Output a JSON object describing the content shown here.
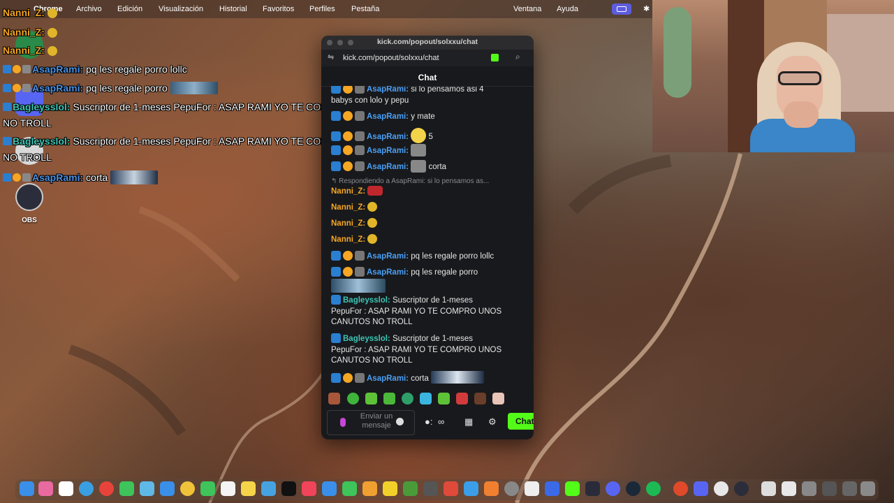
{
  "menubar": {
    "app": "Chrome",
    "items": [
      "Archivo",
      "Edición",
      "Visualización",
      "Historial",
      "Favoritos",
      "Perfiles",
      "Pestaña",
      "Ventana",
      "Ayuda"
    ]
  },
  "overlay": {
    "lines": [
      {
        "user": "Nanni_Z:",
        "text": ""
      },
      {
        "user": "Nanni_Z:",
        "text": ""
      },
      {
        "user": "Nanni_Z:",
        "text": ""
      },
      {
        "user": "AsapRami:",
        "text": " pq les regale porro lollc"
      },
      {
        "user": "AsapRami:",
        "text": " pq les regale porro"
      },
      {
        "user": "Bagleysslol:",
        "text": " Suscriptor de 1-meses PepuFor : ASAP RAMI YO TE COMPRO UNOS CANUTOS"
      },
      {
        "user": "",
        "text": "NO TROLL"
      },
      {
        "user": "Bagleysslol:",
        "text": " Suscriptor de 1-meses PepuFor : ASAP RAMI YO TE COMPRO UNOS CANUTOS"
      },
      {
        "user": "",
        "text": "NO TROLL"
      },
      {
        "user": "AsapRami:",
        "text": " corta"
      }
    ]
  },
  "desktop": {
    "obs_label": "OBS"
  },
  "window": {
    "title": "kick.com/popout/solxxu/chat",
    "url": "kick.com/popout/solxxu/chat",
    "header": "Chat",
    "messages": {
      "m1_user": "AsapRami:",
      "m1_text": " si lo pensamos asi 4",
      "m1b_text": "babys con lolo y pepu",
      "m2_user": "AsapRami:",
      "m2_text": " y mate",
      "m3_user": "AsapRami:",
      "m3_text": "5",
      "m4_user": "AsapRami:",
      "m5_user": "AsapRami:",
      "m5_text": "corta",
      "reply": "Respondiendo a AsapRami: si lo pensamos as...",
      "m6_user": "Nanni_Z:",
      "m7_user": "Nanni_Z:",
      "m8_user": "Nanni_Z:",
      "m9_user": "Nanni_Z:",
      "m10_user": "AsapRami:",
      "m10_text": " pq les regale porro lollc",
      "m11_user": "AsapRami:",
      "m11_text": " pq les regale porro",
      "m12_user": "Bagleysslol:",
      "m12_text": " Suscriptor de 1-meses",
      "m12b_text": "PepuFor : ASAP RAMI YO TE COMPRO UNOS",
      "m12c_text": "CANUTOS NO TROLL",
      "m13_user": "Bagleysslol:",
      "m13_text": " Suscriptor de 1-meses",
      "m13b_text": "PepuFor : ASAP RAMI YO TE COMPRO UNOS",
      "m13c_text": "CANUTOS NO TROLL",
      "m14_user": "AsapRami:",
      "m14_text": " corta"
    },
    "input_placeholder": "Enviar un mensaje",
    "send_label": "Chat",
    "accent": "#53fc18"
  }
}
